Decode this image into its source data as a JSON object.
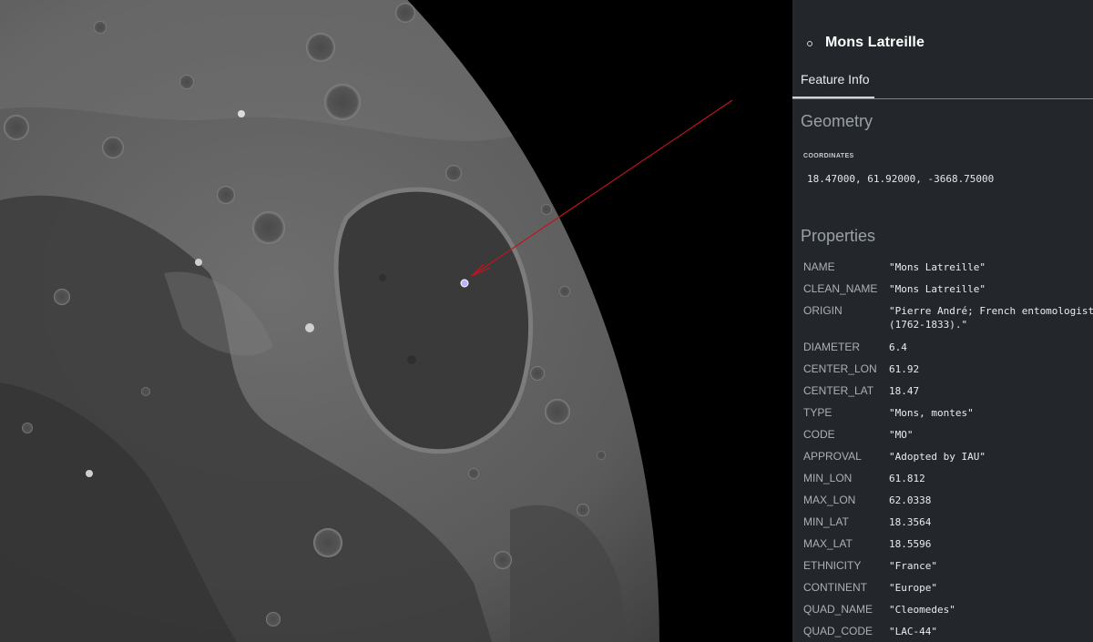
{
  "panel": {
    "title": "Mons Latreille",
    "tabs": [
      "Feature Info"
    ],
    "geometry_heading": "Geometry",
    "coordinates_label": "COORDINATES",
    "coordinates_value": "18.47000, 61.92000, -3668.75000",
    "properties_heading": "Properties",
    "properties": [
      {
        "key": "NAME",
        "value": "\"Mons Latreille\""
      },
      {
        "key": "CLEAN_NAME",
        "value": "\"Mons Latreille\""
      },
      {
        "key": "ORIGIN",
        "value": "\"Pierre André; French entomologist",
        "value2": "(1762-1833).\""
      },
      {
        "key": "DIAMETER",
        "value": "6.4"
      },
      {
        "key": "CENTER_LON",
        "value": "61.92"
      },
      {
        "key": "CENTER_LAT",
        "value": "18.47"
      },
      {
        "key": "TYPE",
        "value": "\"Mons, montes\""
      },
      {
        "key": "CODE",
        "value": "\"MO\""
      },
      {
        "key": "APPROVAL",
        "value": "\"Adopted by IAU\""
      },
      {
        "key": "MIN_LON",
        "value": "61.812"
      },
      {
        "key": "MAX_LON",
        "value": "62.0338"
      },
      {
        "key": "MIN_LAT",
        "value": "18.3564"
      },
      {
        "key": "MAX_LAT",
        "value": "18.5596"
      },
      {
        "key": "ETHNICITY",
        "value": "\"France\""
      },
      {
        "key": "CONTINENT",
        "value": "\"Europe\""
      },
      {
        "key": "QUAD_NAME",
        "value": "\"Cleomedes\""
      },
      {
        "key": "QUAD_CODE",
        "value": "\"LAC-44\""
      }
    ]
  },
  "colors": {
    "panel_bg": "#23272b",
    "pointer_line": "#c0141e",
    "marker": "#b9b0ff"
  },
  "icons": {
    "feature_bullet": "circle-bullet-icon",
    "feature_marker": "map-marker-icon"
  }
}
